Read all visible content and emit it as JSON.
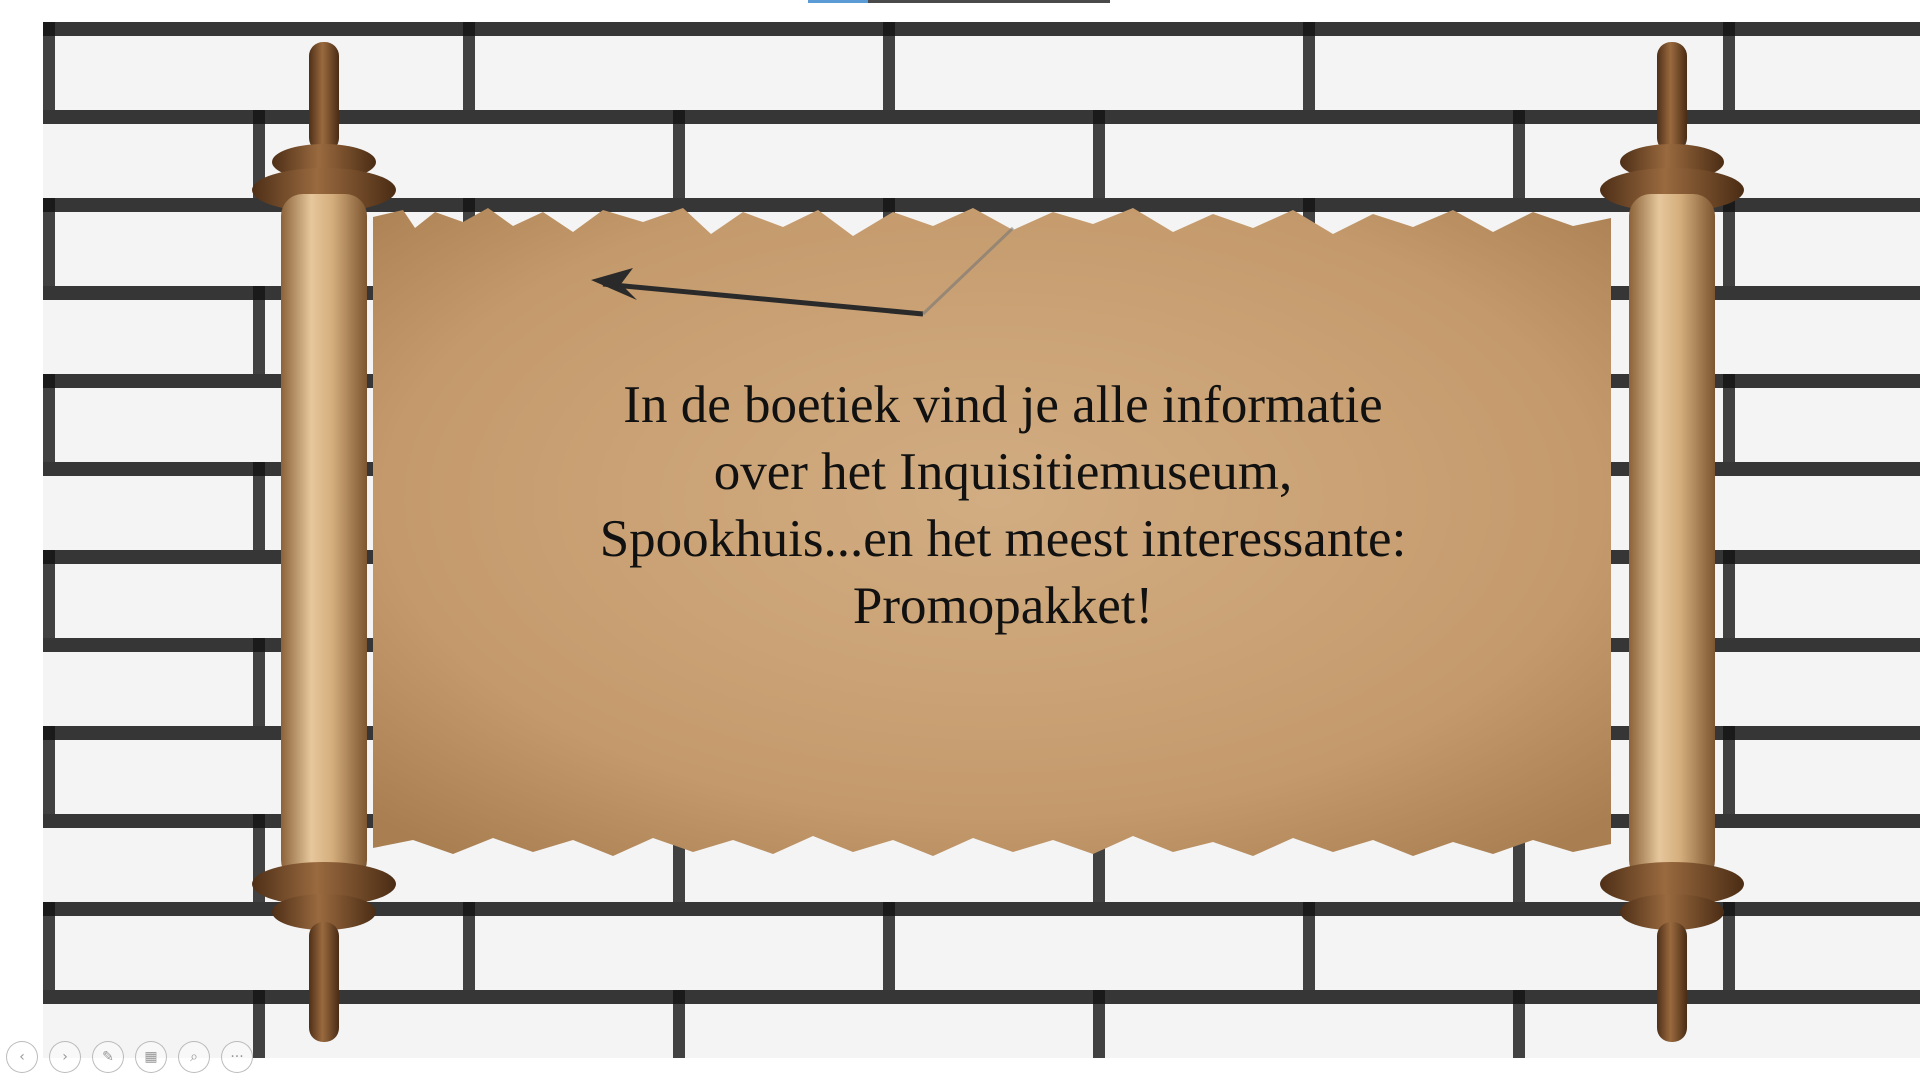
{
  "presentation": {
    "progress_fraction": 0.2,
    "slide_text_lines": [
      "In de boetiek vind je alle informatie",
      "over het Inquisitiemuseum,",
      "Spookhuis...en het meest interessante:",
      "Promopakket!"
    ]
  },
  "slideshow_controls": [
    {
      "name": "previous-slide-button",
      "icon": "chevron-left-icon",
      "glyph": "‹"
    },
    {
      "name": "next-slide-button",
      "icon": "chevron-right-icon",
      "glyph": "›"
    },
    {
      "name": "pen-tool-button",
      "icon": "pen-icon",
      "glyph": "✎"
    },
    {
      "name": "see-all-slides-button",
      "icon": "grid-icon",
      "glyph": "▦"
    },
    {
      "name": "zoom-button",
      "icon": "magnifier-icon",
      "glyph": "⌕"
    },
    {
      "name": "more-options-button",
      "icon": "ellipsis-icon",
      "glyph": "···"
    }
  ],
  "colors": {
    "parchment": "#c9a37a",
    "roller_wood": "#7a4e2d",
    "progress_fill": "#5b9bd5"
  }
}
